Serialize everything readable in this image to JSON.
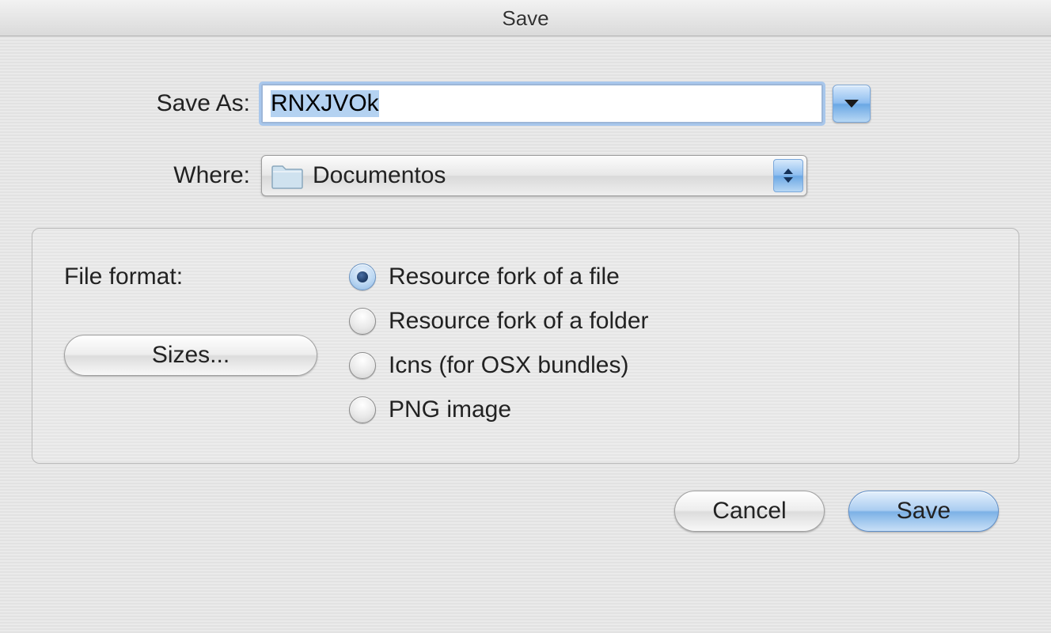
{
  "title": "Save",
  "saveAs": {
    "label": "Save As:",
    "value": "RNXJVOk"
  },
  "where": {
    "label": "Where:",
    "selected": "Documentos"
  },
  "format": {
    "label": "File format:",
    "sizesButton": "Sizes...",
    "options": [
      {
        "label": "Resource fork of a file",
        "checked": true
      },
      {
        "label": "Resource fork of a folder",
        "checked": false
      },
      {
        "label": "Icns (for OSX bundles)",
        "checked": false
      },
      {
        "label": "PNG image",
        "checked": false
      }
    ]
  },
  "buttons": {
    "cancel": "Cancel",
    "save": "Save"
  }
}
